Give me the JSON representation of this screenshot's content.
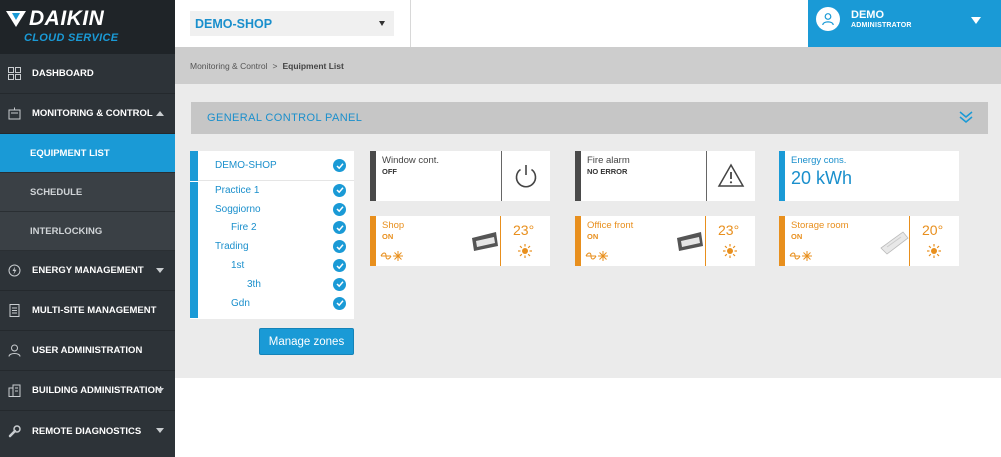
{
  "brand": {
    "name": "DAIKIN",
    "service": "CLOUD SERVICE"
  },
  "sidebar": {
    "items": [
      {
        "label": "DASHBOARD"
      },
      {
        "label": "MONITORING & CONTROL"
      },
      {
        "label": "ENERGY MANAGEMENT"
      },
      {
        "label": "MULTI-SITE MANAGEMENT"
      },
      {
        "label": "USER ADMINISTRATION"
      },
      {
        "label": "BUILDING ADMINISTRATION"
      },
      {
        "label": "REMOTE DIAGNOSTICS"
      }
    ],
    "sub_items": [
      {
        "label": "EQUIPMENT LIST"
      },
      {
        "label": "SCHEDULE"
      },
      {
        "label": "INTERLOCKING"
      }
    ]
  },
  "header": {
    "shop": "DEMO-SHOP",
    "user_name": "DEMO",
    "user_role": "ADMINISTRATOR"
  },
  "breadcrumb": {
    "parent": "Monitoring & Control",
    "separator": ">",
    "current": "Equipment List"
  },
  "panel": {
    "title": "GENERAL CONTROL PANEL"
  },
  "zones": {
    "root": "DEMO-SHOP",
    "items": [
      {
        "label": "Practice 1"
      },
      {
        "label": "Soggiorno"
      },
      {
        "label": "Fire 2"
      },
      {
        "label": "Trading"
      },
      {
        "label": "1st"
      },
      {
        "label": "3th"
      },
      {
        "label": "Gdn"
      }
    ],
    "manage_label": "Manage zones"
  },
  "cards": {
    "window": {
      "title": "Window cont.",
      "value": "OFF"
    },
    "fire": {
      "title": "Fire alarm",
      "value": "NO ERROR"
    },
    "energy": {
      "title": "Energy cons.",
      "value": "20 kWh"
    },
    "shop": {
      "title": "Shop",
      "status": "ON",
      "temp": "23°"
    },
    "office": {
      "title": "Office front",
      "status": "ON",
      "temp": "23°"
    },
    "storage": {
      "title": "Storage room",
      "status": "ON",
      "temp": "20°"
    }
  },
  "colors": {
    "accent": "#1a9ad6",
    "ac": "#e88f1d",
    "sidebar": "#2d3338"
  }
}
